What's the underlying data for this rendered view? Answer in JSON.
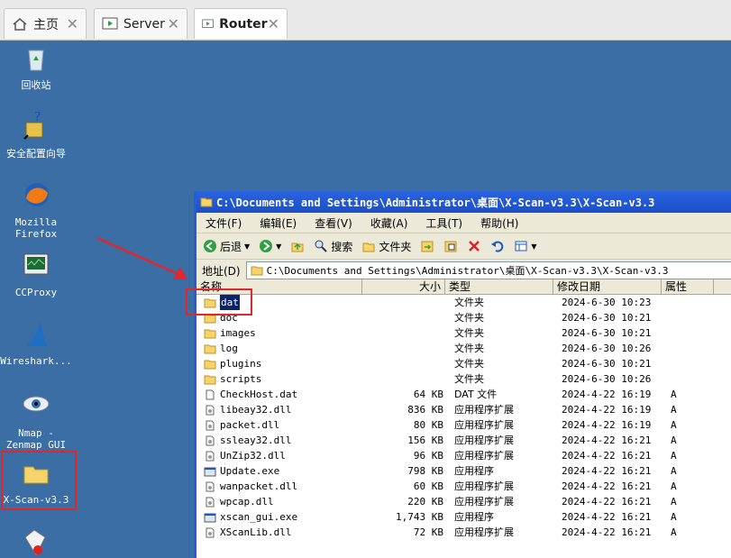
{
  "tabs": [
    {
      "label": "主页",
      "icon": "home-icon"
    },
    {
      "label": "Server",
      "icon": "vm-icon"
    },
    {
      "label": "Router",
      "icon": "vm-icon"
    }
  ],
  "desktop": [
    {
      "label": "回收站",
      "icon": "recycle-bin-icon"
    },
    {
      "label": "安全配置向导",
      "icon": "security-wizard-icon"
    },
    {
      "label": "Mozilla Firefox",
      "icon": "firefox-icon"
    },
    {
      "label": "CCProxy",
      "icon": "ccproxy-icon"
    },
    {
      "label": "Wireshark...",
      "icon": "wireshark-icon"
    },
    {
      "label": "Nmap - Zenmap GUI",
      "icon": "nmap-icon"
    },
    {
      "label": "X-Scan-v3.3",
      "icon": "folder-icon"
    }
  ],
  "window": {
    "title": "C:\\Documents and Settings\\Administrator\\桌面\\X-Scan-v3.3\\X-Scan-v3.3",
    "menu": [
      "文件(F)",
      "编辑(E)",
      "查看(V)",
      "收藏(A)",
      "工具(T)",
      "帮助(H)"
    ],
    "toolbar": {
      "back": "后退",
      "search": "搜索",
      "folders": "文件夹"
    },
    "address_label": "地址(D)",
    "address": "C:\\Documents and Settings\\Administrator\\桌面\\X-Scan-v3.3\\X-Scan-v3.3",
    "columns": [
      "名称",
      "大小",
      "类型",
      "修改日期",
      "属性"
    ],
    "files": [
      {
        "name": "dat",
        "size": "",
        "type": "文件夹",
        "date": "2024-6-30 10:23",
        "attr": "",
        "kind": "folder"
      },
      {
        "name": "doc",
        "size": "",
        "type": "文件夹",
        "date": "2024-6-30 10:21",
        "attr": "",
        "kind": "folder"
      },
      {
        "name": "images",
        "size": "",
        "type": "文件夹",
        "date": "2024-6-30 10:21",
        "attr": "",
        "kind": "folder"
      },
      {
        "name": "log",
        "size": "",
        "type": "文件夹",
        "date": "2024-6-30 10:26",
        "attr": "",
        "kind": "folder"
      },
      {
        "name": "plugins",
        "size": "",
        "type": "文件夹",
        "date": "2024-6-30 10:21",
        "attr": "",
        "kind": "folder"
      },
      {
        "name": "scripts",
        "size": "",
        "type": "文件夹",
        "date": "2024-6-30 10:26",
        "attr": "",
        "kind": "folder"
      },
      {
        "name": "CheckHost.dat",
        "size": "64 KB",
        "type": "DAT 文件",
        "date": "2024-4-22 16:19",
        "attr": "A",
        "kind": "file"
      },
      {
        "name": "libeay32.dll",
        "size": "836 KB",
        "type": "应用程序扩展",
        "date": "2024-4-22 16:19",
        "attr": "A",
        "kind": "dll"
      },
      {
        "name": "packet.dll",
        "size": "80 KB",
        "type": "应用程序扩展",
        "date": "2024-4-22 16:19",
        "attr": "A",
        "kind": "dll"
      },
      {
        "name": "ssleay32.dll",
        "size": "156 KB",
        "type": "应用程序扩展",
        "date": "2024-4-22 16:21",
        "attr": "A",
        "kind": "dll"
      },
      {
        "name": "UnZip32.dll",
        "size": "96 KB",
        "type": "应用程序扩展",
        "date": "2024-4-22 16:21",
        "attr": "A",
        "kind": "dll"
      },
      {
        "name": "Update.exe",
        "size": "798 KB",
        "type": "应用程序",
        "date": "2024-4-22 16:21",
        "attr": "A",
        "kind": "exe"
      },
      {
        "name": "wanpacket.dll",
        "size": "60 KB",
        "type": "应用程序扩展",
        "date": "2024-4-22 16:21",
        "attr": "A",
        "kind": "dll"
      },
      {
        "name": "wpcap.dll",
        "size": "220 KB",
        "type": "应用程序扩展",
        "date": "2024-4-22 16:21",
        "attr": "A",
        "kind": "dll"
      },
      {
        "name": "xscan_gui.exe",
        "size": "1,743 KB",
        "type": "应用程序",
        "date": "2024-4-22 16:21",
        "attr": "A",
        "kind": "exe"
      },
      {
        "name": "XScanLib.dll",
        "size": "72 KB",
        "type": "应用程序扩展",
        "date": "2024-4-22 16:21",
        "attr": "A",
        "kind": "dll"
      }
    ]
  }
}
